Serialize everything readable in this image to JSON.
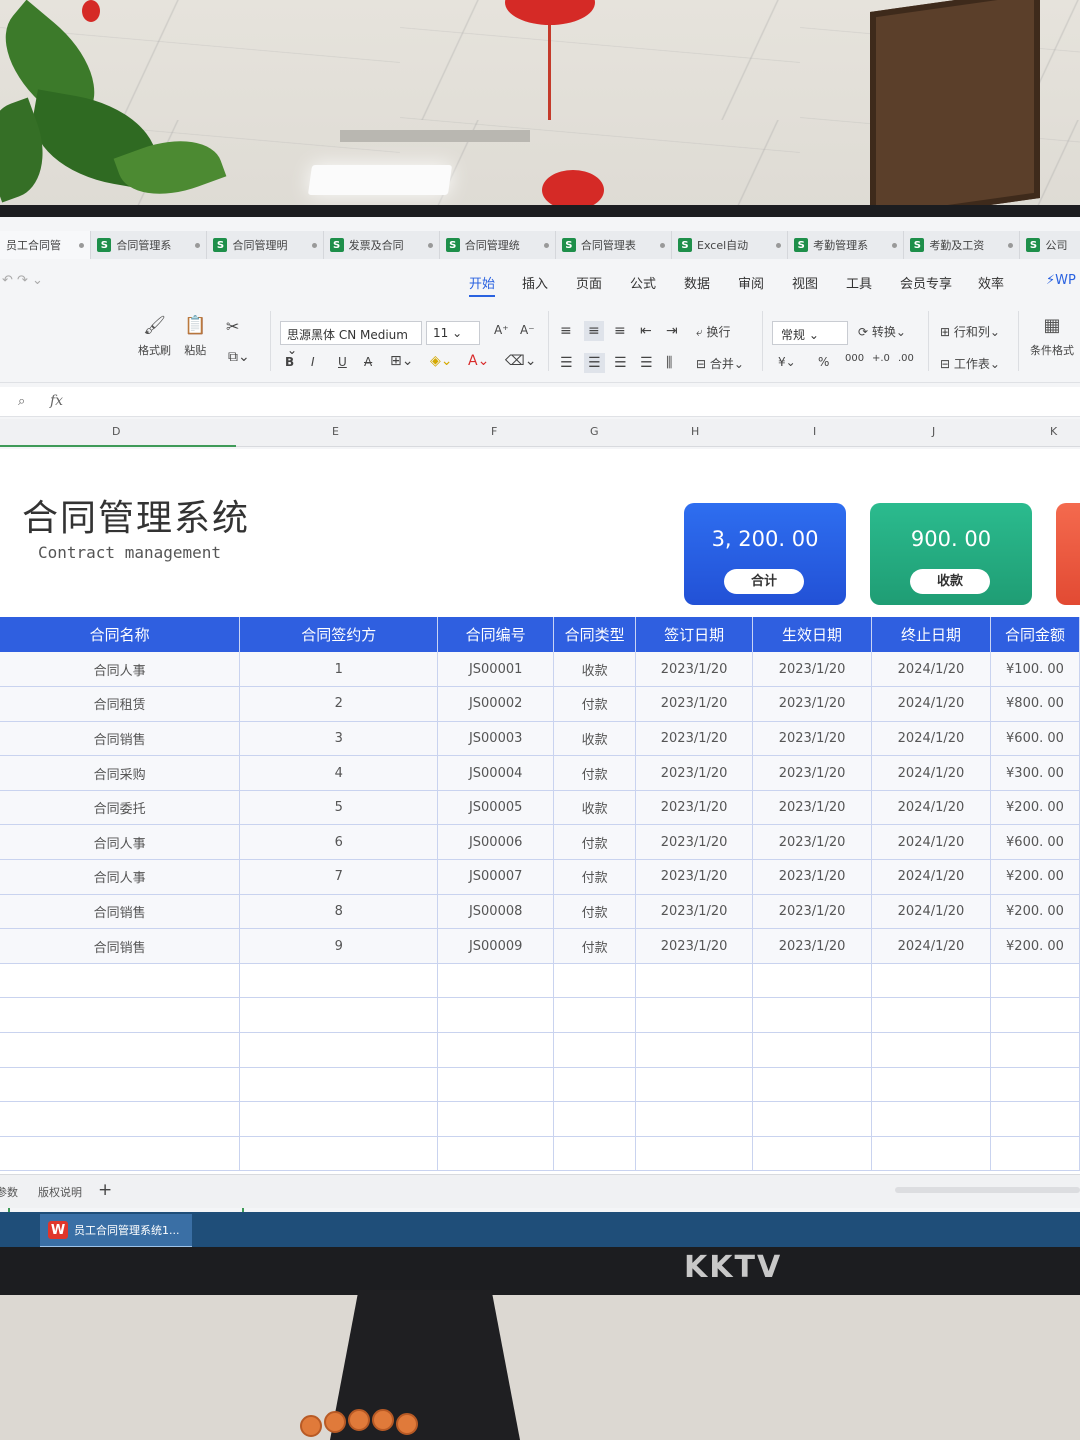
{
  "window_tabs": [
    {
      "label": "员工合同管"
    },
    {
      "label": "合同管理系"
    },
    {
      "label": "合同管理明"
    },
    {
      "label": "发票及合同"
    },
    {
      "label": "合同管理统"
    },
    {
      "label": "合同管理表"
    },
    {
      "label": "Excel自动"
    },
    {
      "label": "考勤管理系"
    },
    {
      "label": "考勤及工资"
    },
    {
      "label": "公司"
    }
  ],
  "menu": {
    "items": [
      "开始",
      "插入",
      "页面",
      "公式",
      "数据",
      "审阅",
      "视图",
      "工具",
      "会员专享",
      "效率"
    ],
    "active": "开始",
    "wps_ai": "WP"
  },
  "ribbon": {
    "format_painter": "格式刷",
    "paste": "粘贴",
    "font_name": "思源黑体 CN Medium",
    "font_size": "11",
    "bold": "B",
    "italic": "I",
    "underline": "U",
    "wrap_text": "换行",
    "merge": "合并",
    "number_format": "常规",
    "convert": "转换",
    "rows_cols": "行和列",
    "worksheet": "工作表",
    "conditional_format": "条件格式",
    "currency": "¥",
    "percent": "%"
  },
  "formula_bar": {
    "fx": "fx"
  },
  "columns": [
    "D",
    "E",
    "F",
    "G",
    "H",
    "I",
    "J",
    "K"
  ],
  "header": {
    "title_cn": "合同管理系统",
    "title_en": "Contract management"
  },
  "cards": [
    {
      "value": "3, 200. 00",
      "label": "合计"
    },
    {
      "value": "900. 00",
      "label": "收款"
    }
  ],
  "table": {
    "headers": [
      "合同名称",
      "合同签约方",
      "合同编号",
      "合同类型",
      "签订日期",
      "生效日期",
      "终止日期",
      "合同金额"
    ],
    "rows": [
      [
        "合同人事",
        "1",
        "JS00001",
        "收款",
        "2023/1/20",
        "2023/1/20",
        "2024/1/20",
        "¥100. 00"
      ],
      [
        "合同租赁",
        "2",
        "JS00002",
        "付款",
        "2023/1/20",
        "2023/1/20",
        "2024/1/20",
        "¥800. 00"
      ],
      [
        "合同销售",
        "3",
        "JS00003",
        "收款",
        "2023/1/20",
        "2023/1/20",
        "2024/1/20",
        "¥600. 00"
      ],
      [
        "合同采购",
        "4",
        "JS00004",
        "付款",
        "2023/1/20",
        "2023/1/20",
        "2024/1/20",
        "¥300. 00"
      ],
      [
        "合同委托",
        "5",
        "JS00005",
        "收款",
        "2023/1/20",
        "2023/1/20",
        "2024/1/20",
        "¥200. 00"
      ],
      [
        "合同人事",
        "6",
        "JS00006",
        "付款",
        "2023/1/20",
        "2023/1/20",
        "2024/1/20",
        "¥600. 00"
      ],
      [
        "合同人事",
        "7",
        "JS00007",
        "付款",
        "2023/1/20",
        "2023/1/20",
        "2024/1/20",
        "¥200. 00"
      ],
      [
        "合同销售",
        "8",
        "JS00008",
        "付款",
        "2023/1/20",
        "2023/1/20",
        "2024/1/20",
        "¥200. 00"
      ],
      [
        "合同销售",
        "9",
        "JS00009",
        "付款",
        "2023/1/20",
        "2023/1/20",
        "2024/1/20",
        "¥200. 00"
      ]
    ]
  },
  "sheet_tabs": [
    "参数",
    "版权说明"
  ],
  "taskbar": {
    "app": "员工合同管理系统1..."
  },
  "monitor_brand": "KKTV",
  "colors": {
    "accent_blue": "#2f5fe0",
    "card_blue": "#2a62e0",
    "card_green": "#26ad82",
    "card_red": "#ec5a40",
    "selection_green": "#3f9a58"
  }
}
